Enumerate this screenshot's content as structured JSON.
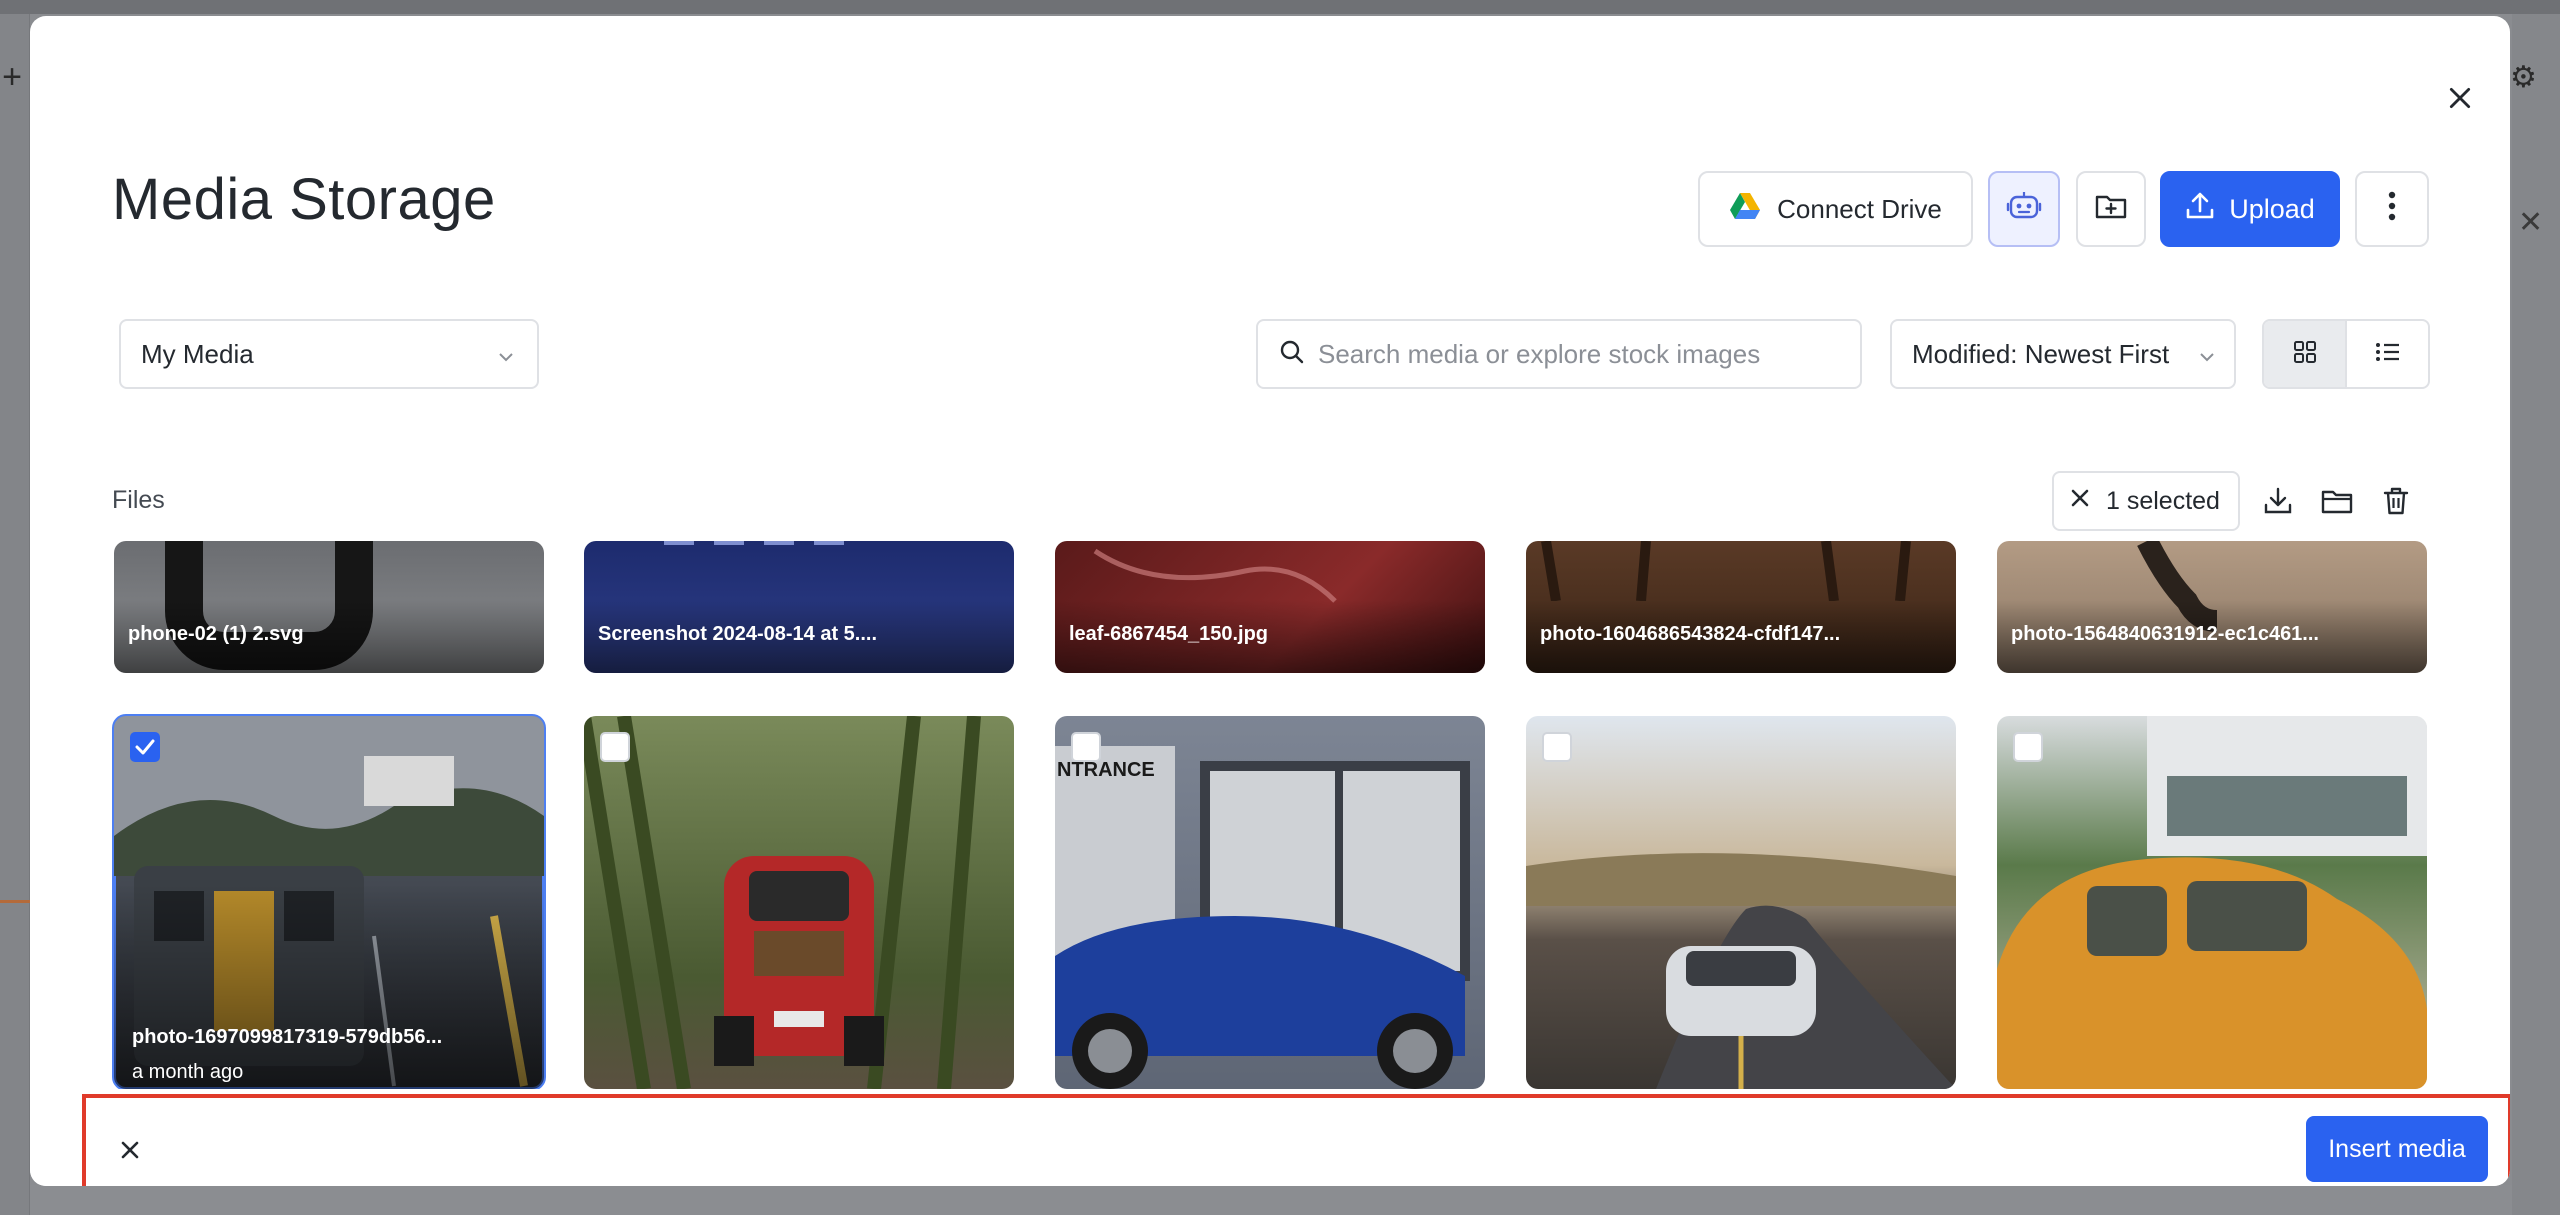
{
  "modal": {
    "title": "Media Storage",
    "close_icon": "close-icon"
  },
  "toolbar": {
    "connect_drive_label": "Connect Drive",
    "upload_label": "Upload",
    "ai_icon": "robot-icon",
    "new_folder_icon": "folder-plus-icon",
    "more_icon": "more-vertical-icon"
  },
  "filters": {
    "source_select": "My Media",
    "search_placeholder": "Search media or explore stock images",
    "sort_select": "Modified: Newest First",
    "view_modes": [
      "grid",
      "list"
    ],
    "active_view": "grid"
  },
  "files": {
    "label": "Files",
    "selected_count_label": "1 selected",
    "actions": [
      "download-icon",
      "move-to-folder-icon",
      "trash-icon"
    ]
  },
  "grid": {
    "row1": [
      {
        "name": "phone-02 (1) 2.svg"
      },
      {
        "name": "Screenshot 2024-08-14 at 5...."
      },
      {
        "name": "leaf-6867454_150.jpg"
      },
      {
        "name": "photo-1604686543824-cfdf147..."
      },
      {
        "name": "photo-1564840631912-ec1c461..."
      }
    ],
    "row2": [
      {
        "name": "photo-1697099817319-579db56...",
        "meta": "a month ago",
        "checked": true
      },
      {
        "name": "",
        "checked": false
      },
      {
        "name": "",
        "checked": false
      },
      {
        "name": "",
        "checked": false
      },
      {
        "name": "",
        "checked": false
      }
    ]
  },
  "footer": {
    "insert_label": "Insert media",
    "cancel_icon": "close-icon"
  },
  "colors": {
    "accent": "#2a62f0",
    "highlight": "#e03a2a"
  }
}
